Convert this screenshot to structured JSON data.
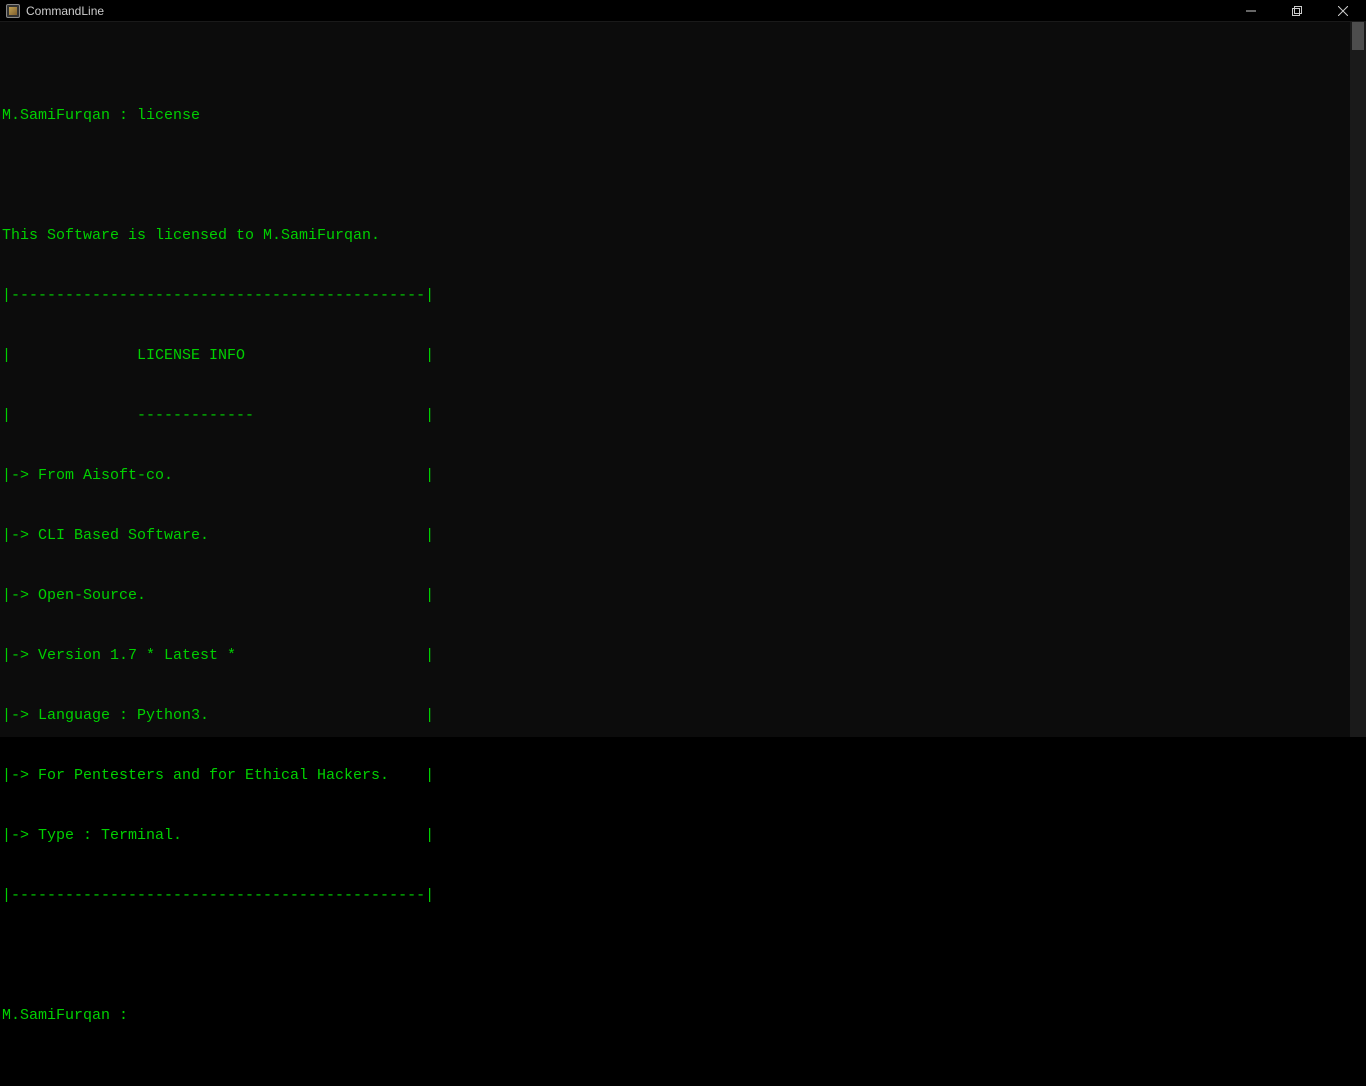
{
  "window": {
    "title": "CommandLine"
  },
  "terminal": {
    "prompt_line_1": "M.SamiFurqan : license",
    "blank_1": "",
    "licensed_to": "This Software is licensed to M.SamiFurqan.",
    "box_top": "|----------------------------------------------|",
    "box_title": "|              LICENSE INFO                    |",
    "box_under": "|              -------------                   |",
    "line_from": "|-> From Aisoft-co.                            |",
    "line_cli": "|-> CLI Based Software.                        |",
    "line_os": "|-> Open-Source.                               |",
    "line_ver": "|-> Version 1.7 * Latest *                     |",
    "line_lang": "|-> Language : Python3.                        |",
    "line_for": "|-> For Pentesters and for Ethical Hackers.    |",
    "line_type": "|-> Type : Terminal.                           |",
    "box_bottom": "|----------------------------------------------|",
    "blank_2": "",
    "prompt_line_2": "M.SamiFurqan : "
  },
  "colors": {
    "text": "#00d000",
    "background": "#0c0c0c"
  }
}
